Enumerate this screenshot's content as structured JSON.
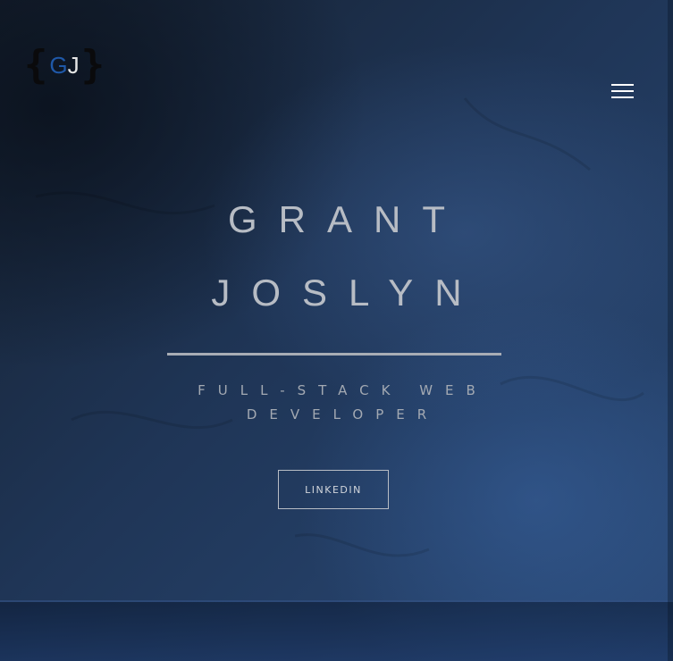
{
  "header": {
    "logo": {
      "brace_open": "{",
      "letter_g": "G",
      "letter_j": "J",
      "brace_close": "}",
      "colors": {
        "brace": "#0a0a0c",
        "g": "#1f58a8",
        "j": "#e6e6e6"
      }
    },
    "menu_icon": "hamburger-menu-icon"
  },
  "hero": {
    "first_name": "GRANT",
    "last_name": "JOSLYN",
    "subtitle_line1": "FULL-STACK WEB",
    "subtitle_line2": "DEVELOPER",
    "cta_label": "LINKEDIN"
  },
  "theme": {
    "background": "#1d2f4a",
    "text": "#b7bcc4",
    "accent": "#2a4a78"
  }
}
